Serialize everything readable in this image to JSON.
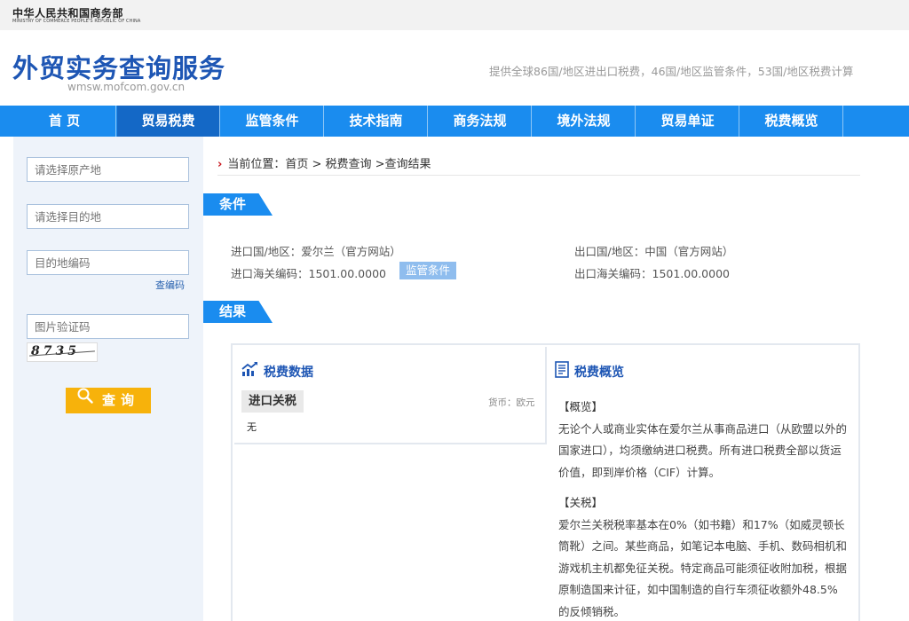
{
  "top": {
    "ministry_cn": "中华人民共和国商务部",
    "ministry_en": "MINISTRY OF COMMERCE PEOPLE'S REPUBLIC OF CHINA"
  },
  "header": {
    "title": "外贸实务查询服务",
    "domain": "wmsw.mofcom.gov.cn",
    "tagline": "提供全球86国/地区进出口税费，46国/地区监管条件，53国/地区税费计算"
  },
  "nav": {
    "items": [
      "首 页",
      "贸易税费",
      "监管条件",
      "技术指南",
      "商务法规",
      "境外法规",
      "贸易单证",
      "税费概览"
    ],
    "active_index": 1
  },
  "sidebar": {
    "origin_placeholder": "请选择原产地",
    "dest_placeholder": "请选择目的地",
    "dest_code_placeholder": "目的地编码",
    "lookup_code_link": "查编码",
    "captcha_placeholder": "图片验证码",
    "captcha_text": "8735",
    "search_label": "查询"
  },
  "breadcrumb": {
    "prefix": "当前位置：",
    "path": "首页 > 税费查询 >查询结果"
  },
  "conditions": {
    "tag": "条件",
    "import_country_label": "进口国/地区：",
    "import_country": "爱尔兰（官方网站）",
    "export_country_label": "出口国/地区：",
    "export_country": "中国（官方网站）",
    "import_code_label": "进口海关编码：",
    "import_code": "1501.00.0000",
    "export_code_label": "出口海关编码：",
    "export_code": "1501.00.0000",
    "regulation_button": "监管条件"
  },
  "results": {
    "tag": "结果",
    "tax_data_title": "税费数据",
    "import_tax_label": "进口关税",
    "currency": "货币：欧元",
    "import_tax_value": "无",
    "overview_title": "税费概览",
    "overview_heading": "【概览】",
    "overview_text": "无论个人或商业实体在爱尔兰从事商品进口（从欧盟以外的国家进口），均须缴纳进口税费。所有进口税费全部以货运价值，即到岸价格（CIF）计算。",
    "tariff_heading": "【关税】",
    "tariff_text": "爱尔兰关税税率基本在0%（如书籍）和17%（如威灵顿长筒靴）之间。某些商品，如笔记本电脑、手机、数码相机和游戏机主机都免征关税。特定商品可能须征收附加税，根据原制造国来计征，如中国制造的自行车须征收额外48.5%的反倾销税。"
  },
  "colors": {
    "nav_blue": "#1a8cef",
    "nav_active": "#1468c6",
    "title_blue": "#1e56b4",
    "search_yellow": "#f7b20b"
  }
}
